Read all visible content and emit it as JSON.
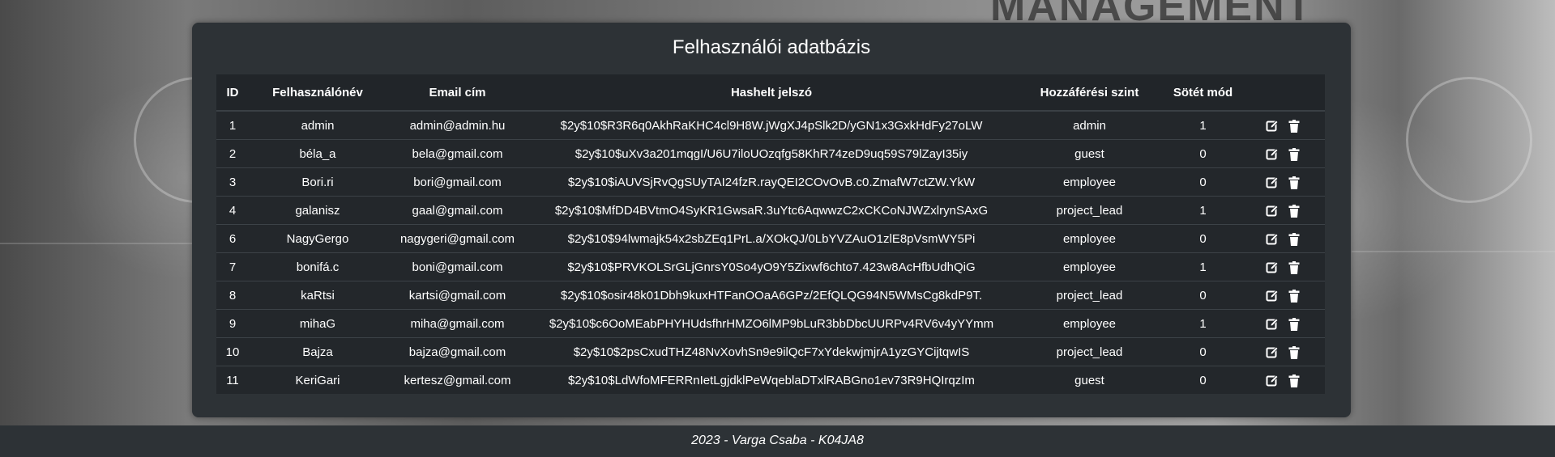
{
  "page": {
    "title": "Felhasználói adatbázis",
    "background_word": "MANAGEMENT",
    "footer": "2023 - Varga Csaba - K04JA8"
  },
  "table": {
    "headers": [
      "ID",
      "Felhasználónév",
      "Email cím",
      "Hashelt jelszó",
      "Hozzáférési szint",
      "Sötét mód",
      ""
    ],
    "rows": [
      {
        "id": "1",
        "username": "admin",
        "email": "admin@admin.hu",
        "hash": "$2y$10$R3R6q0AkhRaKHC4cl9H8W.jWgXJ4pSlk2D/yGN1x3GxkHdFy27oLW",
        "level": "admin",
        "dark": "1"
      },
      {
        "id": "2",
        "username": "béla_a",
        "email": "bela@gmail.com",
        "hash": "$2y$10$uXv3a201mqgI/U6U7iloUOzqfg58KhR74zeD9uq59S79lZayI35iy",
        "level": "guest",
        "dark": "0"
      },
      {
        "id": "3",
        "username": "Bori.ri",
        "email": "bori@gmail.com",
        "hash": "$2y$10$iAUVSjRvQgSUyTAI24fzR.rayQEI2COvOvB.c0.ZmafW7ctZW.YkW",
        "level": "employee",
        "dark": "0"
      },
      {
        "id": "4",
        "username": "galanisz",
        "email": "gaal@gmail.com",
        "hash": "$2y$10$MfDD4BVtmO4SyKR1GwsaR.3uYtc6AqwwzC2xCKCoNJWZxlrynSAxG",
        "level": "project_lead",
        "dark": "1"
      },
      {
        "id": "6",
        "username": "NagyGergo",
        "email": "nagygeri@gmail.com",
        "hash": "$2y$10$94lwmajk54x2sbZEq1PrL.a/XOkQJ/0LbYVZAuO1zlE8pVsmWY5Pi",
        "level": "employee",
        "dark": "0"
      },
      {
        "id": "7",
        "username": "bonifá.c",
        "email": "boni@gmail.com",
        "hash": "$2y$10$PRVKOLSrGLjGnrsY0So4yO9Y5Zixwf6chto7.423w8AcHfbUdhQiG",
        "level": "employee",
        "dark": "1"
      },
      {
        "id": "8",
        "username": "kaRtsi",
        "email": "kartsi@gmail.com",
        "hash": "$2y$10$osir48k01Dbh9kuxHTFanOOaA6GPz/2EfQLQG94N5WMsCg8kdP9T.",
        "level": "project_lead",
        "dark": "0"
      },
      {
        "id": "9",
        "username": "mihaG",
        "email": "miha@gmail.com",
        "hash": "$2y$10$c6OoMEabPHYHUdsfhrHMZO6lMP9bLuR3bbDbcUURPv4RV6v4yYYmm",
        "level": "employee",
        "dark": "1"
      },
      {
        "id": "10",
        "username": "Bajza",
        "email": "bajza@gmail.com",
        "hash": "$2y$10$2psCxudTHZ48NvXovhSn9e9ilQcF7xYdekwjmjrA1yzGYCijtqwIS",
        "level": "project_lead",
        "dark": "0"
      },
      {
        "id": "11",
        "username": "KeriGari",
        "email": "kertesz@gmail.com",
        "hash": "$2y$10$LdWfoMFERRnIetLgjdklPeWqeblaDTxlRABGno1ev73R9HQIrqzIm",
        "level": "guest",
        "dark": "0"
      }
    ]
  },
  "icons": {
    "edit": "edit-icon",
    "delete": "trash-icon"
  }
}
